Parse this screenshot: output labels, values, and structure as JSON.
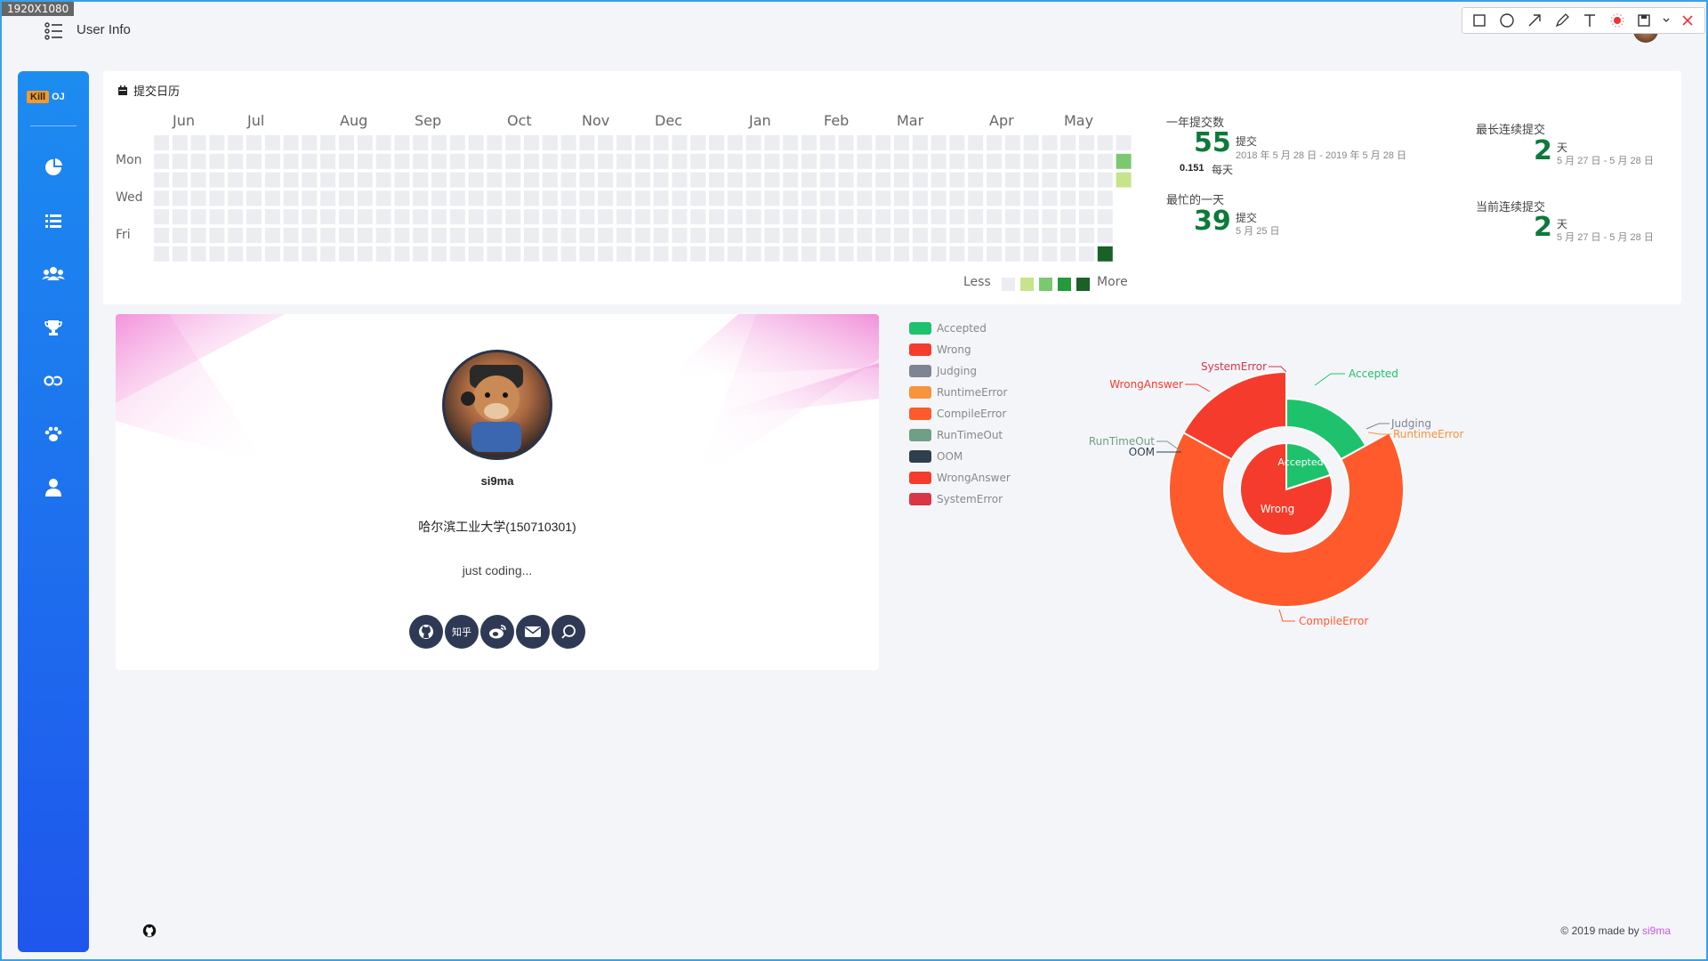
{
  "screen": {
    "badge": "1920X1080"
  },
  "topbar": {
    "title": "User Info"
  },
  "annotation_toolbar": {
    "tools": [
      "rectangle-icon",
      "ellipse-icon",
      "arrow-icon",
      "pen-icon",
      "text-icon",
      "mosaic-icon",
      "save-icon",
      "dropdown-icon",
      "close-icon"
    ]
  },
  "sidebar": {
    "logo_kill": "Kill",
    "logo_oj": "OJ",
    "items": [
      "dashboard-pie-icon",
      "list-icon",
      "users-icon",
      "trophy-icon",
      "link-icon",
      "paw-icon",
      "user-icon"
    ]
  },
  "calendar": {
    "title": "提交日历",
    "months": [
      "Jun",
      "Jul",
      "Aug",
      "Sep",
      "Oct",
      "Nov",
      "Dec",
      "Jan",
      "Feb",
      "Mar",
      "Apr",
      "May"
    ],
    "days": [
      "Mon",
      "Wed",
      "Fri"
    ],
    "legend_less": "Less",
    "legend_more": "More",
    "legend_colors": [
      "#ebedf0",
      "#c6e48b",
      "#7bc96f",
      "#239a3b",
      "#196127"
    ],
    "active_cells": [
      {
        "week": 52,
        "day": 1,
        "level": 2
      },
      {
        "week": 52,
        "day": 2,
        "level": 1
      },
      {
        "week": 51,
        "day": 6,
        "level": 4
      }
    ],
    "stats": {
      "year_label": "一年提交数",
      "year_count": "55",
      "year_unit": "提交",
      "year_range": "2018 年 5 月 28 日 - 2019 年 5 月 28 日",
      "per_day_value": "0.151",
      "per_day_unit": "每天",
      "busiest_label": "最忙的一天",
      "busiest_count": "39",
      "busiest_unit": "提交",
      "busiest_date": "5 月 25 日",
      "longest_label": "最长连续提交",
      "longest_count": "2",
      "longest_unit": "天",
      "longest_range": "5 月 27 日 - 5 月 28 日",
      "current_label": "当前连续提交",
      "current_count": "2",
      "current_unit": "天",
      "current_range": "5 月 27 日 - 5 月 28 日"
    }
  },
  "profile": {
    "name": "si9ma",
    "school": "哈尔滨工业大学(150710301)",
    "bio": "just coding...",
    "social": [
      "github-icon",
      "知乎",
      "weibo-icon",
      "mail-icon",
      "blog-icon"
    ]
  },
  "result_legend": [
    {
      "label": "Accepted",
      "color": "#1ec26d"
    },
    {
      "label": "Wrong",
      "color": "#f53c2c"
    },
    {
      "label": "Judging",
      "color": "#7c8591"
    },
    {
      "label": "RuntimeError",
      "color": "#f6943c"
    },
    {
      "label": "CompileError",
      "color": "#ff5a2c"
    },
    {
      "label": "RunTimeOut",
      "color": "#6f9f86"
    },
    {
      "label": "OOM",
      "color": "#2e3f4d"
    },
    {
      "label": "WrongAnswer",
      "color": "#f53c2c"
    },
    {
      "label": "SystemError",
      "color": "#d83548"
    }
  ],
  "chart_data": {
    "type": "pie",
    "inner": [
      {
        "name": "Accepted",
        "value": 11,
        "color": "#1ec26d"
      },
      {
        "name": "Wrong",
        "value": 44,
        "color": "#f53c2c"
      }
    ],
    "outer": [
      {
        "name": "Accepted",
        "value": 9,
        "color": "#1ec26d"
      },
      {
        "name": "Judging",
        "value": 0,
        "color": "#7c8591"
      },
      {
        "name": "RuntimeError",
        "value": 0,
        "color": "#f6943c"
      },
      {
        "name": "CompileError",
        "value": 35,
        "color": "#ff5a2c"
      },
      {
        "name": "RunTimeOut",
        "value": 0,
        "color": "#6f9f86"
      },
      {
        "name": "OOM",
        "value": 0,
        "color": "#2e3f4d"
      },
      {
        "name": "WrongAnswer",
        "value": 9,
        "color": "#f53c2c"
      },
      {
        "name": "SystemError",
        "value": 0,
        "color": "#d83548"
      }
    ]
  },
  "footer": {
    "copyright": "© 2019 made by ",
    "author": "si9ma"
  }
}
